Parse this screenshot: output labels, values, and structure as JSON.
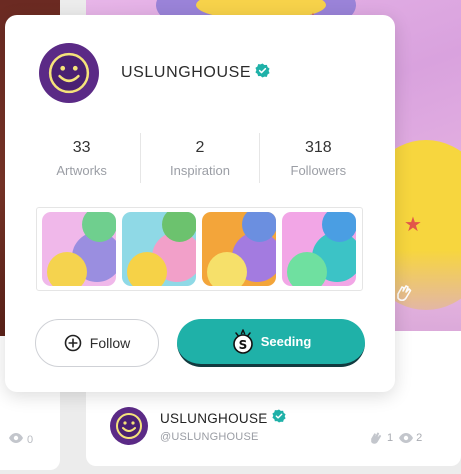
{
  "profile": {
    "name": "USLUNGHOUSE",
    "handle": "@USLUNGHOUSE",
    "verified_badge_color": "#1fb1a8",
    "avatar_bg": "#5b2a86",
    "avatar_icon": "smiley-icon"
  },
  "stats": [
    {
      "value": "33",
      "label": "Artworks"
    },
    {
      "value": "2",
      "label": "Inspiration"
    },
    {
      "value": "318",
      "label": "Followers"
    }
  ],
  "artworks": [
    {
      "name": "artwork-thumb-1",
      "colors": [
        "#f0b8ea",
        "#9a8ee0",
        "#f5d34e",
        "#6fcf8e"
      ]
    },
    {
      "name": "artwork-thumb-2",
      "colors": [
        "#8fd9e6",
        "#f2a0c9",
        "#f6d247",
        "#6cc26e"
      ]
    },
    {
      "name": "artwork-thumb-3",
      "colors": [
        "#f3a53a",
        "#a37be0",
        "#f6e06a",
        "#6b8fe0"
      ]
    },
    {
      "name": "artwork-thumb-4",
      "colors": [
        "#f2a6e6",
        "#3cc3c6",
        "#6fe0a0",
        "#4a9ee3"
      ]
    }
  ],
  "buttons": {
    "follow_label": "Follow",
    "seeding_label": "Seeding",
    "seeding_color": "#1fb1a8"
  },
  "card": {
    "author_name": "USLUNGHOUSE",
    "author_handle": "@USLUNGHOUSE",
    "applause_count": "1",
    "view_count": "2",
    "left_card_view_count": "0"
  }
}
